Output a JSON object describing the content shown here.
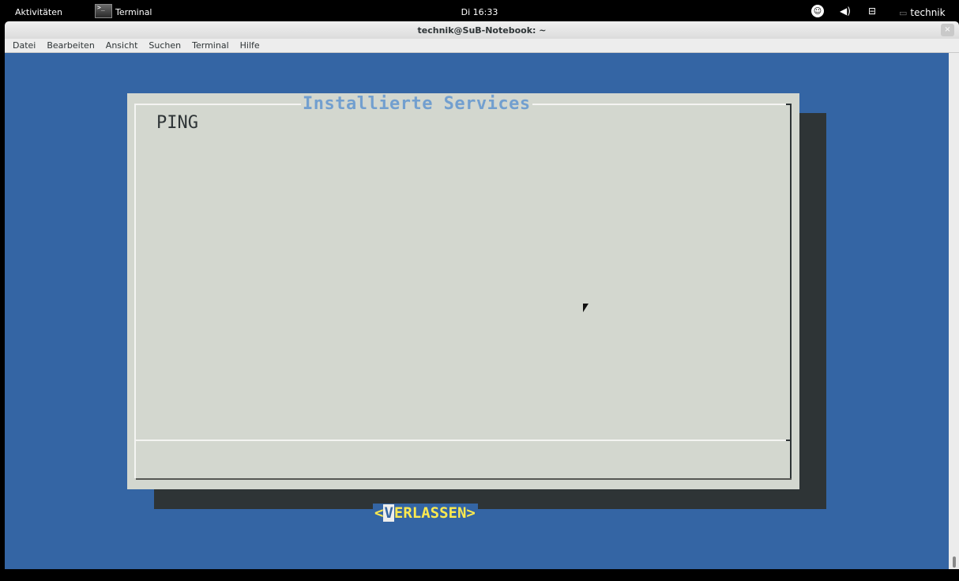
{
  "topbar": {
    "activities": "Aktivitäten",
    "app_name": "Terminal",
    "clock": "Di 16:33",
    "user": "technik"
  },
  "window": {
    "title": "technik@SuB-Notebook: ~",
    "close_glyph": "×",
    "menu": [
      "Datei",
      "Bearbeiten",
      "Ansicht",
      "Suchen",
      "Terminal",
      "Hilfe"
    ]
  },
  "dialog": {
    "title": "Installierte Services",
    "items": [
      "PING"
    ],
    "button": {
      "left_bracket": "<",
      "hotkey": "V",
      "rest": "ERLASSEN",
      "right_bracket": ">"
    }
  },
  "colors": {
    "terminal_bg": "#3465a4",
    "dialog_bg": "#d3d7cf",
    "title_color": "#729fcf",
    "button_text": "#fce94f"
  },
  "icons": {
    "accessibility": "accessibility-icon",
    "volume": "volume-icon",
    "network": "network-icon",
    "chat": "chat-icon",
    "terminal": "terminal-icon",
    "cursor": "mouse-pointer-icon"
  }
}
